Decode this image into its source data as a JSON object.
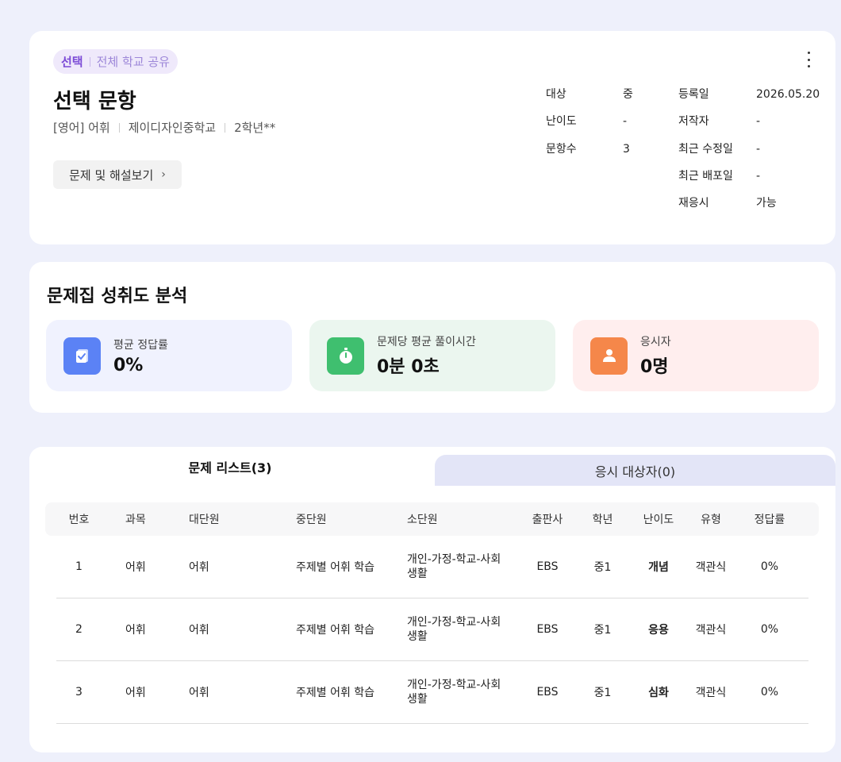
{
  "header": {
    "badge_primary": "선택",
    "badge_secondary": "전체 학교 공유",
    "title": "선택 문항",
    "subject": "[영어] 어휘",
    "school": "제이디자인중학교",
    "grade": "2학년**",
    "view_button_label": "문제 및 해설보기",
    "meta_left": [
      {
        "label": "대상",
        "value": "중"
      },
      {
        "label": "난이도",
        "value": "-"
      },
      {
        "label": "문항수",
        "value": "3"
      }
    ],
    "meta_right": [
      {
        "label": "등록일",
        "value": "2026.05.20"
      },
      {
        "label": "저작자",
        "value": "-"
      },
      {
        "label": "최근 수정일",
        "value": "-"
      },
      {
        "label": "최근 배포일",
        "value": "-"
      },
      {
        "label": "재응시",
        "value": "가능"
      }
    ]
  },
  "analysis": {
    "title": "문제집 성취도 분석",
    "stats": [
      {
        "label": "평균 정답률",
        "value": "0%",
        "icon": "document-check-icon",
        "bg": "#f0f2fe",
        "icon_bg": "#5b82f5"
      },
      {
        "label": "문제당 평균 풀이시간",
        "value": "0분 0초",
        "icon": "stopwatch-icon",
        "bg": "#ebf6ef",
        "icon_bg": "#3fbf6f"
      },
      {
        "label": "응시자",
        "value": "0명",
        "icon": "person-icon",
        "bg": "#ffeeee",
        "icon_bg": "#f5874a"
      }
    ]
  },
  "tabs": {
    "active": "문제 리스트(3)",
    "inactive": "응시 대상자(0)"
  },
  "table": {
    "headers": [
      "번호",
      "과목",
      "대단원",
      "중단원",
      "소단원",
      "출판사",
      "학년",
      "난이도",
      "유형",
      "정답률"
    ],
    "rows": [
      [
        "1",
        "어휘",
        "어휘",
        "주제별 어휘 학습",
        "개인-가정-학교-사회 생활",
        "EBS",
        "중1",
        "개념",
        "객관식",
        "0%"
      ],
      [
        "2",
        "어휘",
        "어휘",
        "주제별 어휘 학습",
        "개인-가정-학교-사회 생활",
        "EBS",
        "중1",
        "응용",
        "객관식",
        "0%"
      ],
      [
        "3",
        "어휘",
        "어휘",
        "주제별 어휘 학습",
        "개인-가정-학교-사회 생활",
        "EBS",
        "중1",
        "심화",
        "객관식",
        "0%"
      ]
    ]
  }
}
